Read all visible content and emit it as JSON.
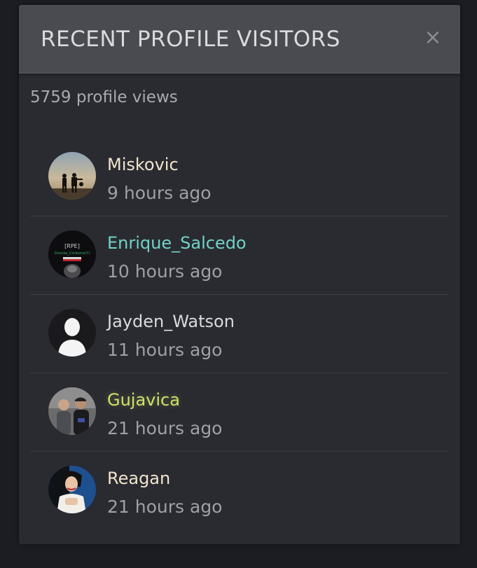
{
  "modal": {
    "title": "RECENT PROFILE VISITORS",
    "close_glyph": "×"
  },
  "views_count": "5759 profile views",
  "visitors": [
    {
      "name": "Miskovic",
      "time": "9 hours ago",
      "name_color": "#f1e3cc",
      "avatar": "soldiers-silhouette-avatar"
    },
    {
      "name": "Enrique_Salcedo",
      "time": "10 hours ago",
      "name_color": "#6fd3c6",
      "avatar": "rpe-gang-logo-avatar",
      "avatar_texts": [
        "[RPE]",
        "Dzonka_Corleone(Y)"
      ]
    },
    {
      "name": "Jayden_Watson",
      "time": "11 hours ago",
      "name_color": "#d9dadc",
      "avatar": "default-person-avatar"
    },
    {
      "name": "Gujavica",
      "time": "21 hours ago",
      "name_color": "#cfe06a",
      "avatar": "two-men-photo-avatar"
    },
    {
      "name": "Reagan",
      "time": "21 hours ago",
      "name_color": "#f1e3cc",
      "avatar": "woman-portrait-avatar"
    }
  ],
  "colors": {
    "background": "#1c1d22",
    "panel": "#2a2b31",
    "header": "#4a4b50",
    "muted_text": "#9fa0a3"
  }
}
